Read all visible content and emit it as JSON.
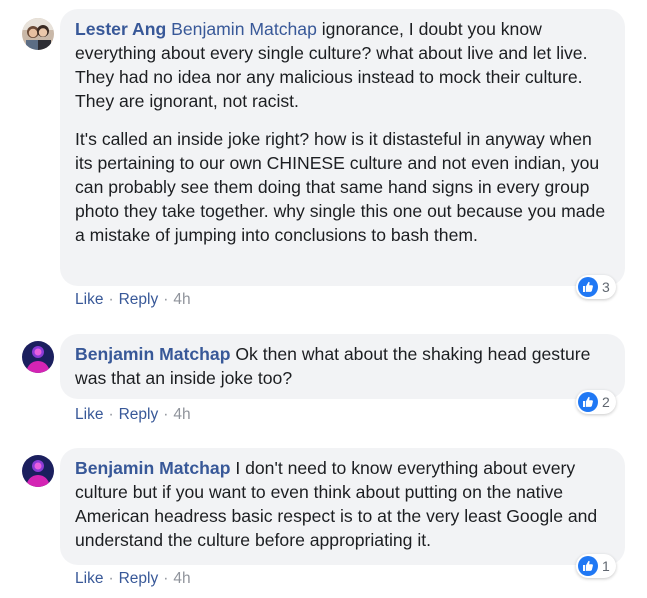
{
  "comments": [
    {
      "author": "Lester Ang",
      "mention": "Benjamin Matchap",
      "paragraphs": [
        " ignorance, I doubt you know everything about every single culture? what about live and let live. They had no idea nor any malicious instead to mock their culture. They are ignorant, not racist.",
        "It's called an inside joke right? how is it distasteful in anyway when its pertaining to our own CHINESE culture and not even indian, you can probably see them doing that same hand signs in every group photo they take together. why single this one out because you made a mistake of jumping into conclusions to bash them."
      ],
      "reactions": {
        "icon": "like-icon",
        "count": "3"
      },
      "actions": {
        "like": "Like",
        "reply": "Reply",
        "time": "4h",
        "separator": "·"
      }
    },
    {
      "author": "Benjamin Matchap",
      "text": " Ok then what about the shaking head gesture was that an inside joke too?",
      "reactions": {
        "icon": "like-icon",
        "count": "2"
      },
      "actions": {
        "like": "Like",
        "reply": "Reply",
        "time": "4h",
        "separator": "·"
      }
    },
    {
      "author": "Benjamin Matchap",
      "text": " I don't need to know everything about every culture but if you want to even think about putting on the native American headress basic respect is to at the very least Google and understand the culture before appropriating it.",
      "reactions": {
        "icon": "like-icon",
        "count": "1"
      },
      "actions": {
        "like": "Like",
        "reply": "Reply",
        "time": "4h",
        "separator": "·"
      }
    }
  ],
  "colors": {
    "link": "#385898",
    "bubble": "#f2f3f5",
    "text": "#1c1e21",
    "meta": "#90949c",
    "like_blue": "#2078f4"
  }
}
